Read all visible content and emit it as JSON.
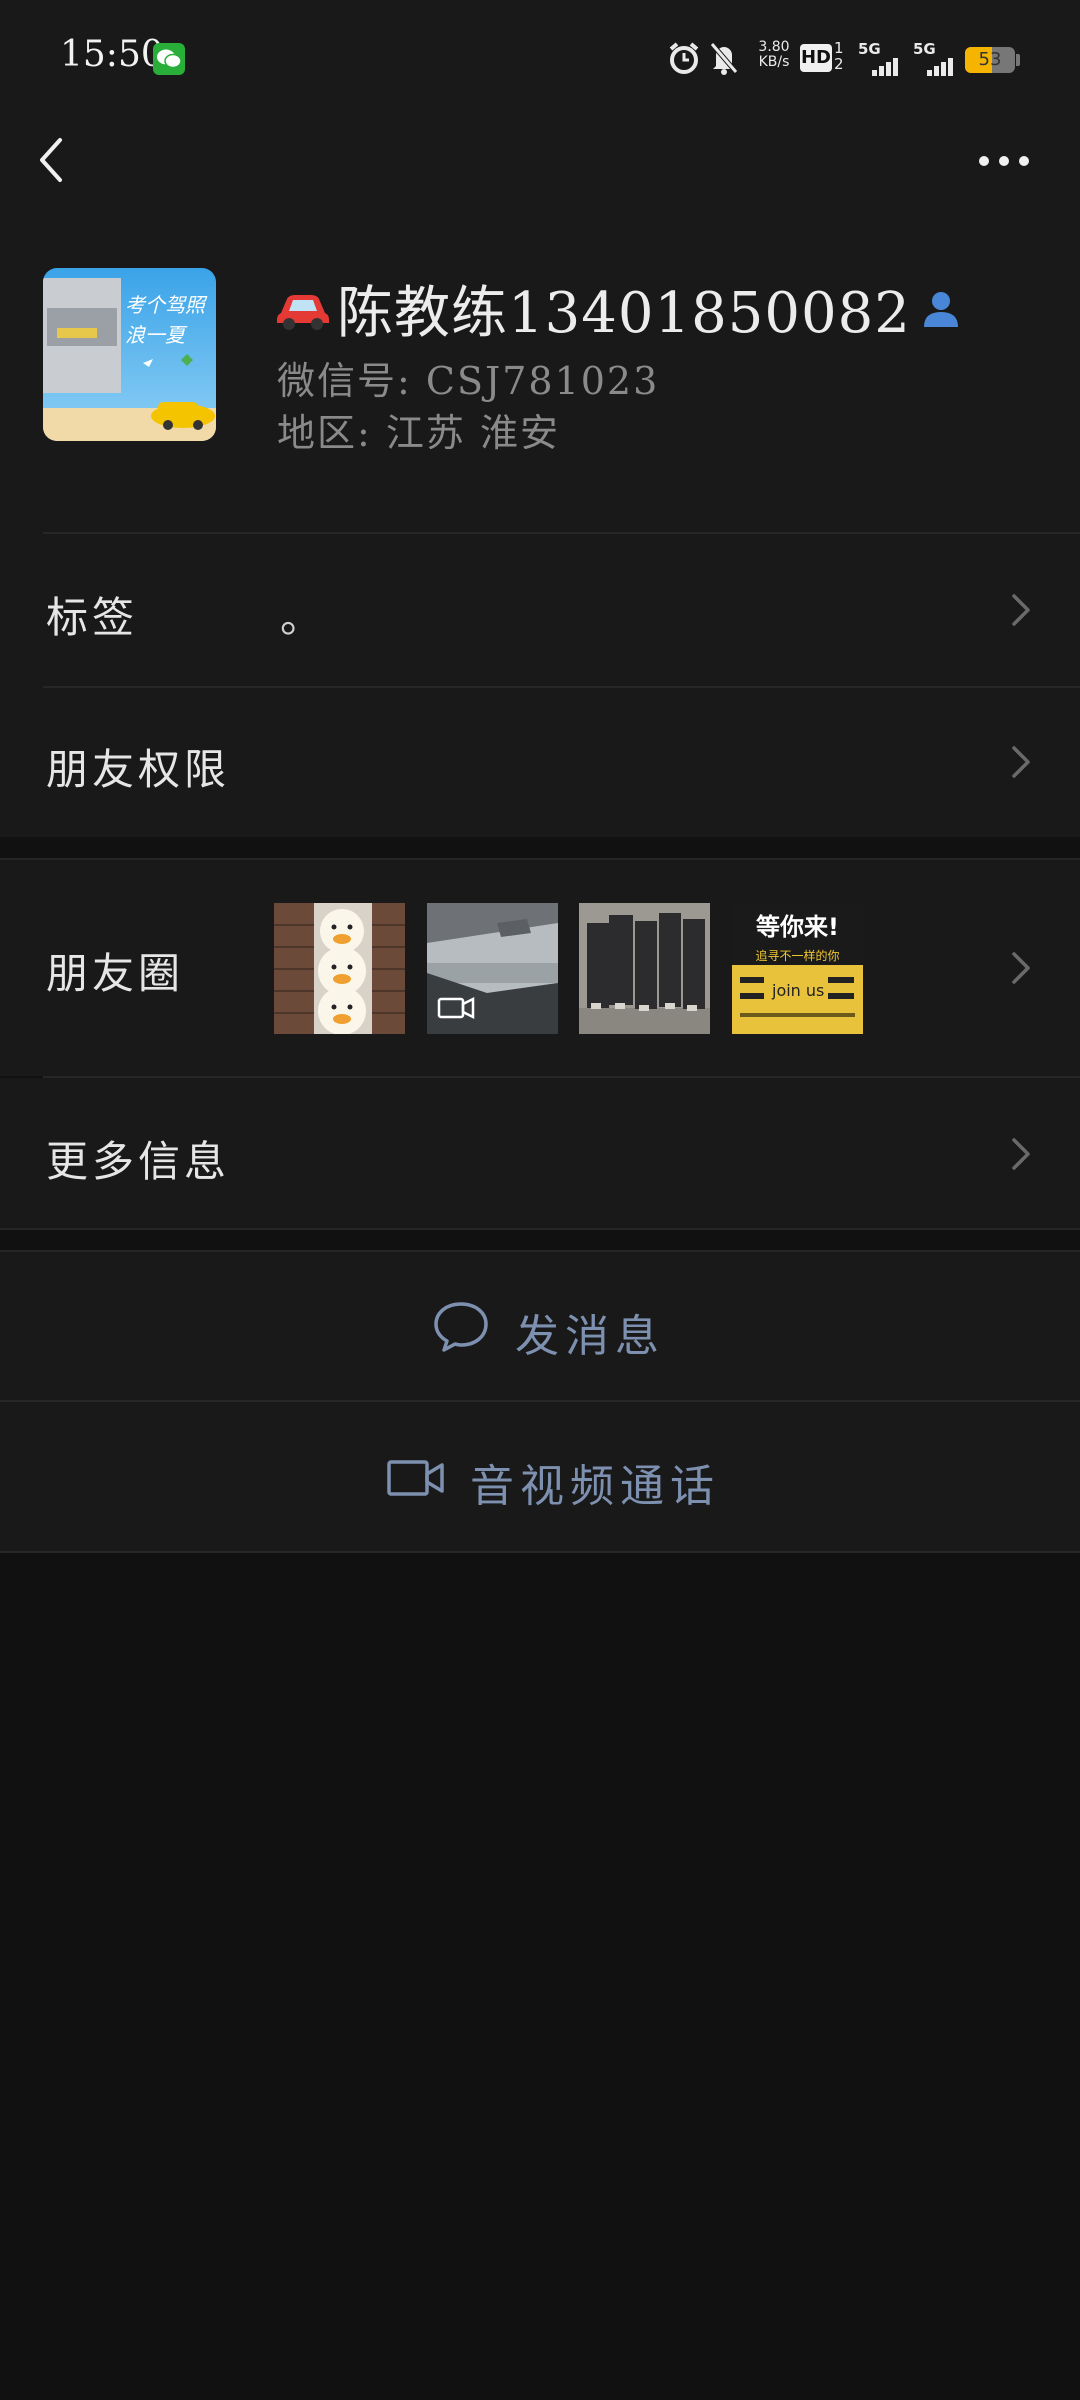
{
  "status_bar": {
    "time": "15:50",
    "net_speed_value": "3.80",
    "net_speed_unit": "KB/s",
    "hd_label": "HD",
    "hd_sub_top": "1",
    "hd_sub_bottom": "2",
    "sim1_label": "5G",
    "sim2_label": "5G",
    "battery_level": "53"
  },
  "nav": {
    "back_icon": "chevron-left-icon",
    "more_icon": "more-dots-icon"
  },
  "profile": {
    "name": "陈教练13401850082",
    "wechat_id": "微信号: CSJ781023",
    "region": "地区: 江苏 淮安",
    "avatar_caption": "考个驾照 浪一夏"
  },
  "rows": {
    "tags_label": "标签",
    "tags_value": "。",
    "permissions_label": "朋友权限",
    "moments_label": "朋友圈",
    "more_info_label": "更多信息"
  },
  "moments_thumbs": {
    "poster_title": "等你来!",
    "poster_sub": "追寻不一样的你",
    "poster_join": "join us"
  },
  "actions": {
    "message_label": "发消息",
    "call_label": "音视频通话"
  },
  "colors": {
    "background": "#191919",
    "action_text": "#7d90b0",
    "battery": "#f5b400"
  }
}
